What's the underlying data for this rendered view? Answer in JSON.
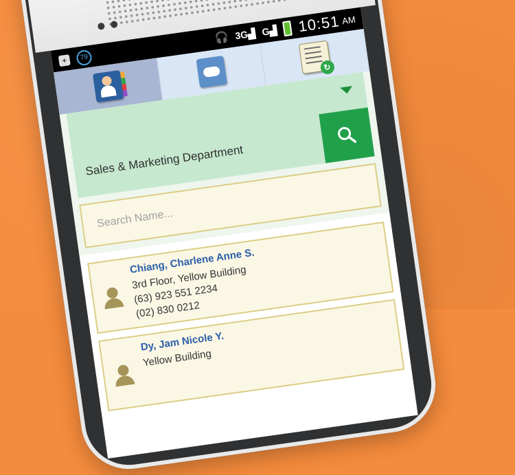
{
  "status_bar": {
    "notification_count": "79",
    "network_1": "3G",
    "network_2": "G",
    "time": "10:51",
    "ampm": "AM"
  },
  "tabs": [
    {
      "name": "contacts",
      "icon": "contacts-book-icon",
      "active": true
    },
    {
      "name": "cloud",
      "icon": "cloud-contacts-icon",
      "active": false
    },
    {
      "name": "sync",
      "icon": "sync-notebook-icon",
      "active": false
    }
  ],
  "department": {
    "selected": "Sales & Marketing Department"
  },
  "search": {
    "placeholder": "Search Name..."
  },
  "contacts": [
    {
      "name": "Chiang, Charlene Anne S.",
      "location": "3rd Floor, Yellow Building",
      "phone_mobile": "(63) 923 551 2234",
      "phone_landline": "(02) 830 0212"
    },
    {
      "name": "Dy, Jam Nicole Y.",
      "location": "Yellow Building",
      "phone_mobile": "",
      "phone_landline": ""
    }
  ],
  "colors": {
    "background": "#f58b3c",
    "accent_green": "#21a04a",
    "name_blue": "#2a5ea8",
    "card_border": "#dccd86"
  }
}
